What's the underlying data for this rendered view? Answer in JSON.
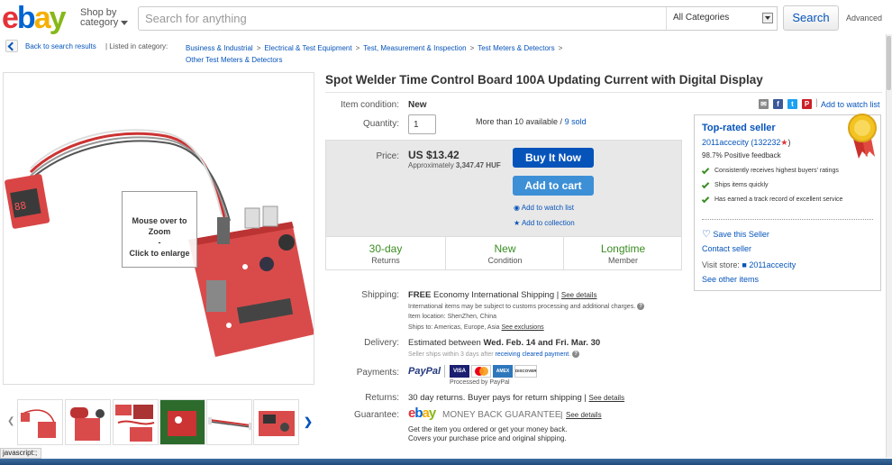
{
  "header": {
    "logo": [
      "e",
      "b",
      "a",
      "y"
    ],
    "shop_by": "Shop by",
    "category": "category",
    "search_placeholder": "Search for anything",
    "category_select": "All Categories",
    "search_button": "Search",
    "advanced": "Advanced"
  },
  "breadcrumb": {
    "back": "Back to search results",
    "listed_in": "| Listed in category:",
    "items": [
      "Business & Industrial",
      "Electrical & Test Equipment",
      "Test, Measurement & Inspection",
      "Test Meters & Detectors",
      "Other Test Meters & Detectors"
    ],
    "separator": ">"
  },
  "image_panel": {
    "zoom_line1": "Mouse over to Zoom",
    "zoom_line2": "-",
    "zoom_line3": "Click to enlarge"
  },
  "item": {
    "title": "Spot Welder Time Control Board 100A Updating Current with Digital Display",
    "condition_label": "Item condition:",
    "condition_value": "New",
    "quantity_label": "Quantity:",
    "quantity_value": "1",
    "availability": "More than 10 available /",
    "sold": "9 sold",
    "watch_list_top": "Add to watch list",
    "price_label": "Price:",
    "price": "US $13.42",
    "approx": "Approximately",
    "approx_value": "3,347.47 HUF",
    "buy_now": "Buy It Now",
    "add_to_cart": "Add to cart",
    "add_watch": "Add to watch list",
    "add_collection": "Add to collection",
    "stats": [
      {
        "big": "30-day",
        "small": "Returns"
      },
      {
        "big": "New",
        "small": "Condition"
      },
      {
        "big": "Longtime",
        "small": "Member"
      }
    ]
  },
  "seller": {
    "heading": "Top-rated seller",
    "name": "2011accecity",
    "score": "(132232",
    "score_close": ")",
    "feedback": "98.7% Positive feedback",
    "bullets": [
      "Consistently receives highest buyers' ratings",
      "Ships items quickly",
      "Has earned a track record of excellent service"
    ],
    "save_seller": "Save this Seller",
    "contact": "Contact seller",
    "visit_store": "Visit store:",
    "store_name": "2011accecity",
    "see_other": "See other items"
  },
  "details": {
    "shipping_label": "Shipping:",
    "shipping_free": "FREE",
    "shipping_method": "Economy International Shipping |",
    "see_details": "See details",
    "intl_note": "International items may be subject to customs processing and additional charges.",
    "item_location": "Item location:  ShenZhen, China",
    "ships_to": "Ships to:  Americas, Europe, Asia",
    "see_exclusions": "See exclusions",
    "delivery_label": "Delivery:",
    "delivery_text": "Estimated between",
    "delivery_dates": "Wed. Feb. 14 and Fri. Mar. 30",
    "seller_ships": "Seller ships within 3 days after",
    "receiving_payment": "receiving cleared payment",
    "seller_ships_end": ".",
    "payments_label": "Payments:",
    "paypal": "PayPal",
    "processed": "Processed by PayPal",
    "card_labels": [
      "VISA",
      "MC",
      "AMEX",
      "DISCOVER"
    ],
    "returns_label": "Returns:",
    "returns_text": "30 day returns. Buyer pays for return shipping |",
    "returns_details": "See details",
    "guarantee_label": "Guarantee:",
    "guarantee_text": "MONEY BACK GUARANTEE",
    "guarantee_sep": "|",
    "guarantee_details": "See details",
    "guarantee_line1": "Get the item you ordered or get your money back.",
    "guarantee_line2": "Covers your purchase price and original shipping."
  },
  "status_bar": "javascript:;",
  "colors": {
    "link": "#0654ba",
    "buy_button": "#0654ba",
    "cart_button": "#3d8fd6",
    "green": "#3a8d22"
  }
}
